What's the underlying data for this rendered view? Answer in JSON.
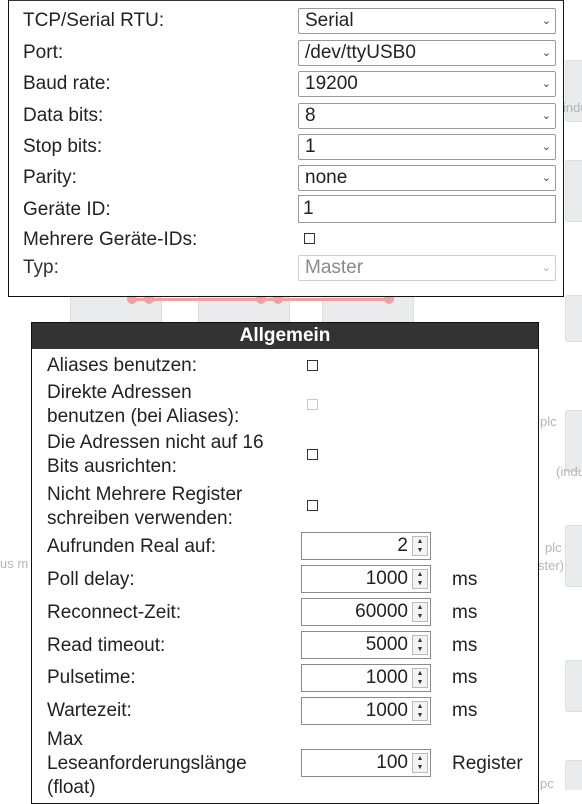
{
  "connection": {
    "tcp_serial": {
      "label": "TCP/Serial RTU:",
      "value": "Serial"
    },
    "port": {
      "label": "Port:",
      "value": "/dev/ttyUSB0"
    },
    "baud": {
      "label": "Baud rate:",
      "value": "19200"
    },
    "data_bits": {
      "label": "Data bits:",
      "value": "8"
    },
    "stop_bits": {
      "label": "Stop bits:",
      "value": "1"
    },
    "parity": {
      "label": "Parity:",
      "value": "none"
    },
    "device_id": {
      "label": "Geräte ID:",
      "value": "1"
    },
    "multi_ids": {
      "label": "Mehrere Geräte-IDs:",
      "checked": false
    },
    "type": {
      "label": "Typ:",
      "value": "Master",
      "disabled": true
    }
  },
  "general": {
    "title": "Allgemein",
    "aliases": {
      "label": "Aliases benutzen:",
      "checked": false
    },
    "direct": {
      "label1": "Direkte Adressen",
      "label2": "benutzen (bei Aliases):",
      "checked": false,
      "disabled": true
    },
    "align": {
      "label1": "Die Adressen nicht auf 16",
      "label2": "Bits ausrichten:",
      "checked": false
    },
    "multi_write": {
      "label1": "Nicht Mehrere Register",
      "label2": "schreiben verwenden:",
      "checked": false
    },
    "round": {
      "label": "Aufrunden Real auf:",
      "value": "2"
    },
    "poll": {
      "label": "Poll delay:",
      "value": "1000",
      "unit": "ms"
    },
    "reconnect": {
      "label": "Reconnect-Zeit:",
      "value": "60000",
      "unit": "ms"
    },
    "read_timeout": {
      "label": "Read timeout:",
      "value": "5000",
      "unit": "ms"
    },
    "pulse": {
      "label": "Pulsetime:",
      "value": "1000",
      "unit": "ms"
    },
    "wait": {
      "label": "Wartezeit:",
      "value": "1000",
      "unit": "ms"
    },
    "max_len": {
      "label1": "Max",
      "label2": "Leseanforderungslänge",
      "label3": "(float)",
      "value": "100",
      "unit": "Register"
    }
  },
  "background": {
    "texts": [
      "indu",
      "plc",
      "(indu",
      "us m",
      "plc",
      "ster)",
      "pc"
    ]
  },
  "icons": {
    "select_arrow": "chevron-down-icon",
    "spinner": "spinner-arrows-icon"
  }
}
